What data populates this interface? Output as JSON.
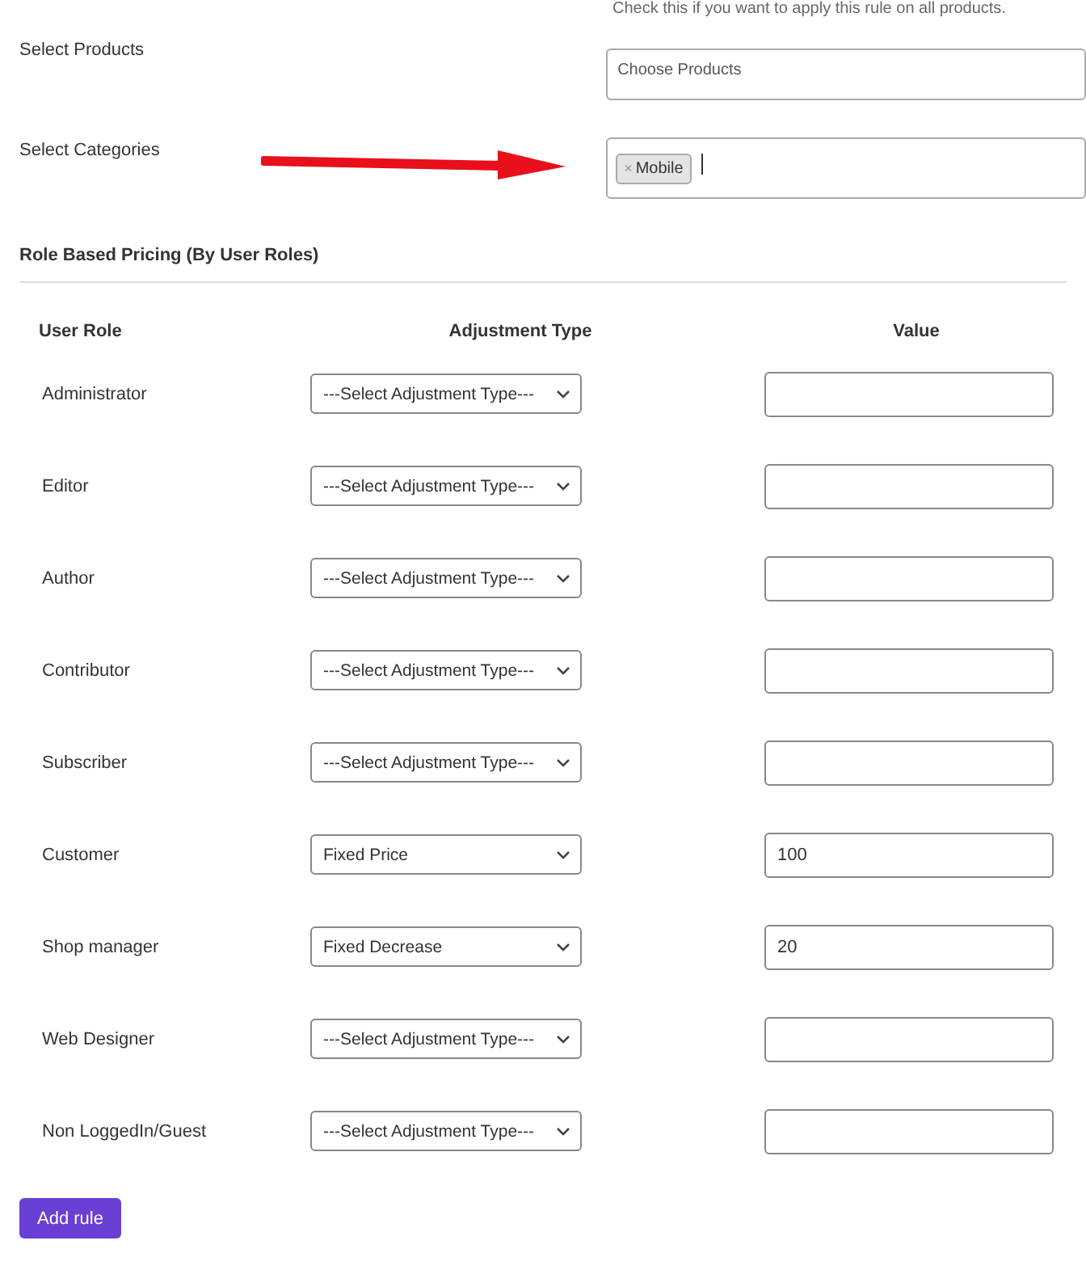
{
  "top_hint": "Check this if you want to apply this rule on all products.",
  "products": {
    "label": "Select Products",
    "placeholder": "Choose Products"
  },
  "categories": {
    "label": "Select Categories",
    "tags": [
      {
        "label": "Mobile",
        "remove": "×"
      }
    ]
  },
  "section_title": "Role Based Pricing (By User Roles)",
  "table": {
    "columns": [
      "User Role",
      "Adjustment Type",
      "Value"
    ],
    "rows": [
      {
        "role": "Administrator",
        "adjustment": "---Select Adjustment Type---"
      },
      {
        "role": "Editor",
        "adjustment": "---Select Adjustment Type---"
      },
      {
        "role": "Author",
        "adjustment": "---Select Adjustment Type---"
      },
      {
        "role": "Contributor",
        "adjustment": "---Select Adjustment Type---"
      },
      {
        "role": "Subscriber",
        "adjustment": "---Select Adjustment Type---"
      },
      {
        "role": "Customer",
        "adjustment": "Fixed Price",
        "value": "100"
      },
      {
        "role": "Shop manager",
        "adjustment": "Fixed Decrease",
        "value": "20"
      },
      {
        "role": "Web Designer",
        "adjustment": "---Select Adjustment Type---"
      },
      {
        "role": "Non LoggedIn/Guest",
        "adjustment": "---Select Adjustment Type---"
      }
    ]
  },
  "add_button": "Add rule"
}
